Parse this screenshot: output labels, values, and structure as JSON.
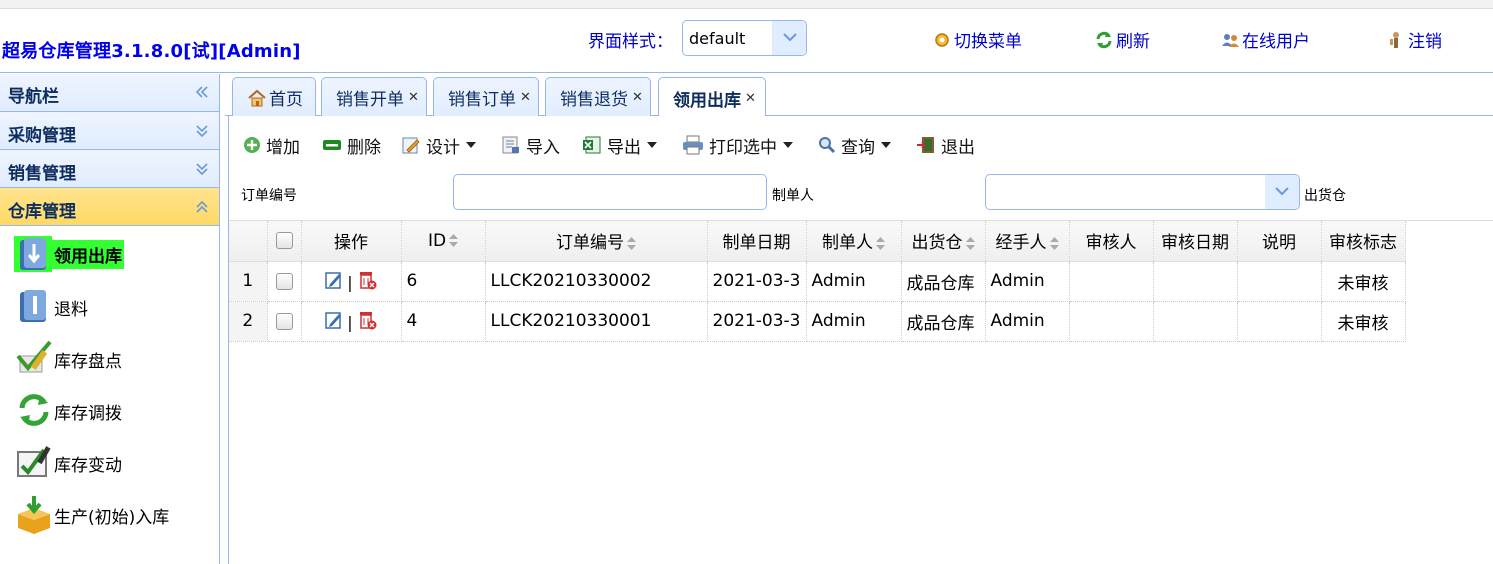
{
  "header": {
    "title": "超易仓库管理3.1.8.0[试][Admin]",
    "theme_label": "界面样式：",
    "theme_value": "default",
    "buttons": {
      "switch_menu": "切换菜单",
      "refresh": "刷新",
      "online_users": "在线用户",
      "logout": "注销"
    }
  },
  "sidebar": {
    "nav_title": "导航栏",
    "sections": [
      "采购管理",
      "销售管理",
      "仓库管理"
    ],
    "active_section": "仓库管理",
    "items": [
      {
        "label": "领用出库",
        "icon": "stock-out-icon"
      },
      {
        "label": "退料",
        "icon": "return-material-icon"
      },
      {
        "label": "库存盘点",
        "icon": "inventory-check-icon"
      },
      {
        "label": "库存调拨",
        "icon": "stock-transfer-icon"
      },
      {
        "label": "库存变动",
        "icon": "stock-change-icon"
      },
      {
        "label": "生产(初始)入库",
        "icon": "stock-in-icon"
      }
    ],
    "active_item": "领用出库"
  },
  "tabs": [
    {
      "label": "首页",
      "closable": false
    },
    {
      "label": "销售开单",
      "closable": true
    },
    {
      "label": "销售订单",
      "closable": true
    },
    {
      "label": "销售退货",
      "closable": true
    },
    {
      "label": "领用出库",
      "closable": true
    }
  ],
  "active_tab": "领用出库",
  "toolbar": {
    "add": "增加",
    "delete": "删除",
    "design": "设计",
    "import": "导入",
    "export": "导出",
    "print_selected": "打印选中",
    "query": "查询",
    "exit": "退出"
  },
  "filters": {
    "order_no_label": "订单编号",
    "maker_label": "制单人",
    "warehouse_label": "出货仓",
    "order_no_value": "",
    "maker_value": ""
  },
  "grid": {
    "columns": [
      "操作",
      "ID",
      "订单编号",
      "制单日期",
      "制单人",
      "出货仓",
      "经手人",
      "审核人",
      "审核日期",
      "说明",
      "审核标志"
    ],
    "rows": [
      {
        "rownum": "1",
        "id": "6",
        "order_no": "LLCK20210330002",
        "date": "2021-03-3",
        "maker": "Admin",
        "warehouse": "成品仓库",
        "handler": "Admin",
        "auditor": "",
        "audit_date": "",
        "note": "",
        "audit_flag": "未审核"
      },
      {
        "rownum": "2",
        "id": "4",
        "order_no": "LLCK20210330001",
        "date": "2021-03-3",
        "maker": "Admin",
        "warehouse": "成品仓库",
        "handler": "Admin",
        "auditor": "",
        "audit_date": "",
        "note": "",
        "audit_flag": "未审核"
      }
    ]
  },
  "colors": {
    "accent_blue": "#0000ee",
    "panel_border": "#95b8e7",
    "active_highlight": "#33ff33",
    "active_section_bg": "#ffd966"
  }
}
